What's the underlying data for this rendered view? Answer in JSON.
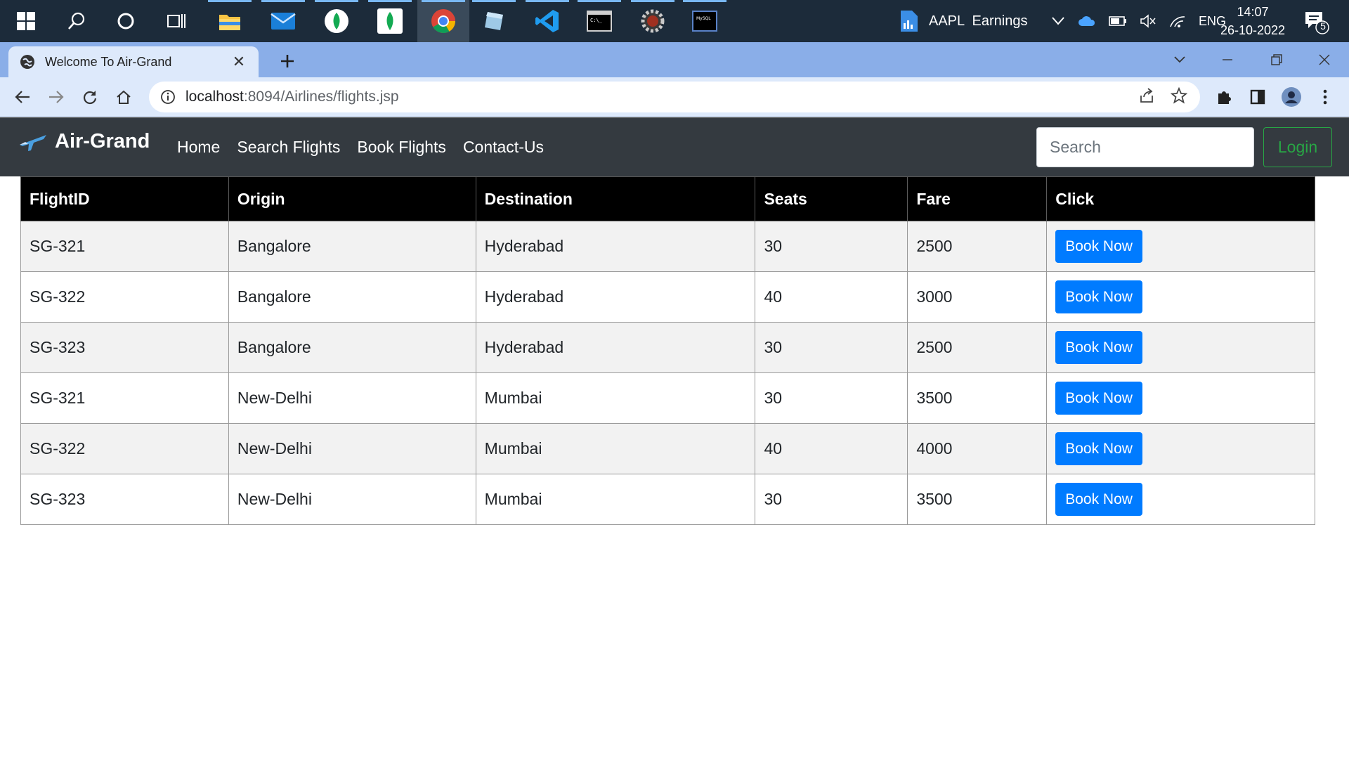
{
  "taskbar": {
    "apps": [
      {
        "name": "windows-start-icon"
      },
      {
        "name": "search-icon"
      },
      {
        "name": "cortana-icon"
      },
      {
        "name": "task-view-icon"
      },
      {
        "name": "file-explorer-icon"
      },
      {
        "name": "mail-icon"
      },
      {
        "name": "mongodb-compass-icon"
      },
      {
        "name": "mongodb-icon"
      },
      {
        "name": "chrome-icon"
      },
      {
        "name": "notepad-app-icon"
      },
      {
        "name": "vscode-icon"
      },
      {
        "name": "terminal-icon"
      },
      {
        "name": "settings-gear-app-icon"
      },
      {
        "name": "mysql-icon"
      }
    ],
    "widget_label": "AAPL  Earnings",
    "language": "ENG",
    "time": "14:07",
    "date": "26-10-2022",
    "notification_count": "5"
  },
  "browser": {
    "tab_title": "Welcome To Air-Grand",
    "url_host": "localhost",
    "url_rest": ":8094/Airlines/flights.jsp"
  },
  "navbar": {
    "brand": "Air-Grand",
    "links": [
      "Home",
      "Search Flights",
      "Book Flights",
      "Contact-Us"
    ],
    "search_placeholder": "Search",
    "login_label": "Login"
  },
  "table": {
    "headers": [
      "FlightID",
      "Origin",
      "Destination",
      "Seats",
      "Fare",
      "Click"
    ],
    "button_label": "Book Now",
    "rows": [
      [
        "SG-321",
        "Bangalore",
        "Hyderabad",
        "30",
        "2500"
      ],
      [
        "SG-322",
        "Bangalore",
        "Hyderabad",
        "40",
        "3000"
      ],
      [
        "SG-323",
        "Bangalore",
        "Hyderabad",
        "30",
        "2500"
      ],
      [
        "SG-321",
        "New-Delhi",
        "Mumbai",
        "30",
        "3500"
      ],
      [
        "SG-322",
        "New-Delhi",
        "Mumbai",
        "40",
        "4000"
      ],
      [
        "SG-323",
        "New-Delhi",
        "Mumbai",
        "30",
        "3500"
      ]
    ]
  },
  "colors": {
    "navbar_bg": "#343a40",
    "primary": "#007bff",
    "success": "#28a745",
    "table_header_bg": "#000000"
  }
}
